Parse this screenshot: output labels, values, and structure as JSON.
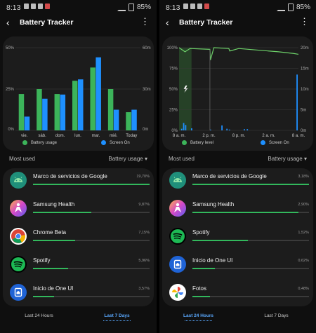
{
  "status": {
    "time": "8:13",
    "battery": "85%"
  },
  "screens": [
    {
      "title": "Battery Tracker",
      "legend": [
        "Battery usage",
        "Screen On"
      ],
      "most_used": "Most used",
      "sort_label": "Battery usage",
      "tabs": [
        "Last 24 Hours",
        "Last 7 Days"
      ],
      "active_tab": 1,
      "apps": [
        {
          "name": "Marco de servicios de Google",
          "percent": "19,70%",
          "value": 19.7,
          "icon": "android-icon"
        },
        {
          "name": "Samsung Health",
          "percent": "9,87%",
          "value": 9.87,
          "icon": "samsung-health-icon"
        },
        {
          "name": "Chrome Beta",
          "percent": "7,15%",
          "value": 7.15,
          "icon": "chrome-beta-icon"
        },
        {
          "name": "Spotify",
          "percent": "5,96%",
          "value": 5.96,
          "icon": "spotify-icon"
        },
        {
          "name": "Inicio de One UI",
          "percent": "3,57%",
          "value": 3.57,
          "icon": "one-ui-home-icon"
        }
      ]
    },
    {
      "title": "Battery Tracker",
      "legend": [
        "Battery level",
        "Screen On"
      ],
      "most_used": "Most used",
      "sort_label": "Battery usage",
      "tabs": [
        "Last 24 Hours",
        "Last 7 Days"
      ],
      "active_tab": 0,
      "apps": [
        {
          "name": "Marco de servicios de Google",
          "percent": "3,18%",
          "value": 3.18,
          "icon": "android-icon"
        },
        {
          "name": "Samsung Health",
          "percent": "2,90%",
          "value": 2.9,
          "icon": "samsung-health-icon"
        },
        {
          "name": "Spotify",
          "percent": "1,52%",
          "value": 1.52,
          "icon": "spotify-icon"
        },
        {
          "name": "Inicio de One UI",
          "percent": "0,62%",
          "value": 0.62,
          "icon": "one-ui-home-icon"
        },
        {
          "name": "Fotos",
          "percent": "0,48%",
          "value": 0.48,
          "icon": "photos-icon"
        }
      ]
    }
  ],
  "colors": {
    "battery": "#3cb45a",
    "screen": "#1e90ff",
    "line": "#6ed36a"
  },
  "chart_data": [
    {
      "type": "bar",
      "categories": [
        "vie.",
        "sáb.",
        "dom.",
        "lun.",
        "mar.",
        "mié.",
        "Today"
      ],
      "series": [
        {
          "name": "Battery usage",
          "axis": "left",
          "values": [
            22,
            25,
            22,
            30,
            38,
            25,
            11
          ]
        },
        {
          "name": "Screen On",
          "axis": "right",
          "values": [
            10,
            23,
            26,
            37,
            53,
            15,
            15
          ]
        }
      ],
      "yticks_left": [
        "0%",
        "25%",
        "50%"
      ],
      "yticks_right": [
        "0m",
        "30m",
        "60m"
      ],
      "ylim_left": [
        0,
        50
      ],
      "ylim_right": [
        0,
        60
      ]
    },
    {
      "type": "line",
      "xticks": [
        "8 a. m.",
        "2 p. m.",
        "8 p. m.",
        "2 a. m.",
        "8 a. m."
      ],
      "yticks_left": [
        "0%",
        "25%",
        "50%",
        "75%",
        "100%"
      ],
      "yticks_right": [
        "0m",
        "5m",
        "10m",
        "15m",
        "20m"
      ],
      "ylim_left": [
        0,
        100
      ],
      "ylim_right": [
        0,
        20
      ],
      "series": [
        {
          "name": "Battery level",
          "axis": "left",
          "x": [
            0,
            1.2,
            2.2,
            6.2,
            6.3,
            7,
            10,
            10.2,
            12,
            16,
            20,
            23,
            24
          ],
          "values": [
            100,
            95,
            99,
            98,
            85,
            100,
            99,
            96,
            99,
            97,
            95,
            93,
            92
          ]
        },
        {
          "name": "Screen On",
          "axis": "right",
          "x": [
            0.4,
            0.8,
            1.2,
            2.4,
            6.2,
            8.5,
            9.5,
            10,
            13,
            13.6,
            23.6
          ],
          "values": [
            0.4,
            1.8,
            1.3,
            0.5,
            0.2,
            1.2,
            0.4,
            0.2,
            0.3,
            0.3,
            13.5
          ]
        }
      ],
      "charging_band": {
        "x": [
          0,
          2.5
        ]
      }
    }
  ]
}
